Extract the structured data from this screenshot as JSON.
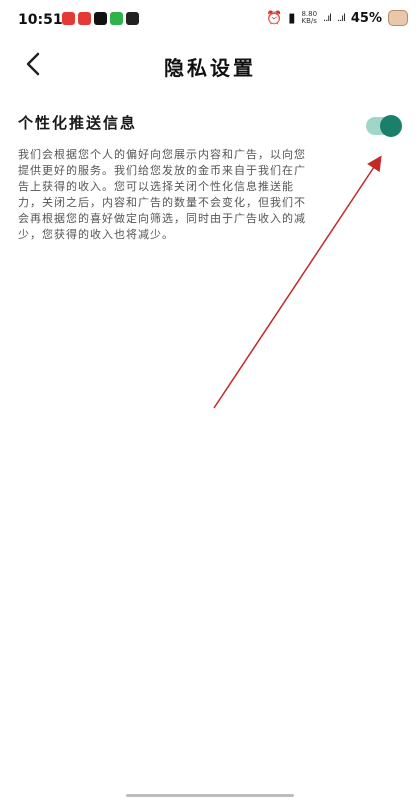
{
  "status_bar": {
    "time": "10:51",
    "net_speed_value": "8.80",
    "net_speed_unit": "KB/s",
    "signal_1": "..ıl",
    "signal_2": "..ıl",
    "battery": "45%",
    "app_colors": [
      "#e53935",
      "#e53935",
      "#111111",
      "#2fb24a",
      "#222222"
    ]
  },
  "header": {
    "title": "隐私设置"
  },
  "setting": {
    "label": "个性化推送信息",
    "description": "我们会根据您个人的偏好向您展示内容和广告，以向您提供更好的服务。我们给您发放的金币来自于我们在广告上获得的收入。您可以选择关闭个性化信息推送能力，关闭之后，内容和广告的数量不会变化，但我们不会再根据您的喜好做定向筛选，同时由于广告收入的减少，您获得的收入也将减少。",
    "toggle_on": true,
    "accent_color": "#1a7f6b"
  },
  "annotation": {
    "color": "#c62828"
  }
}
